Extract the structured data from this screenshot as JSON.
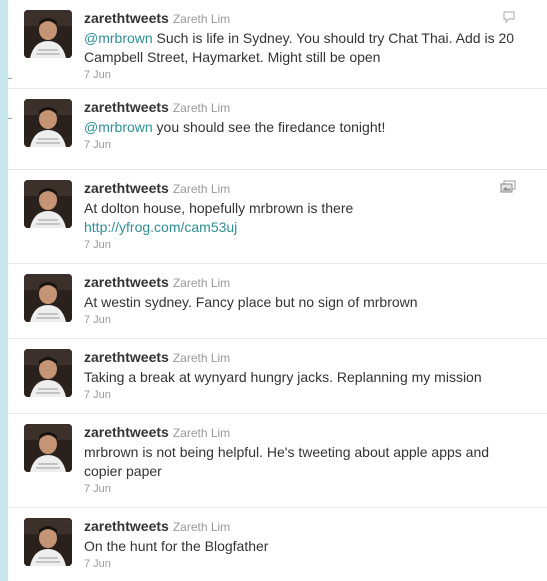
{
  "tweets": [
    {
      "screen_name": "zarethtweets",
      "full_name": "Zareth Lim",
      "mention": "@mrbrown",
      "text": " Such is life in Sydney. You should try Chat Thai. Add is 20 Campbell Street, Haymarket. Might still be open",
      "link": "",
      "time": "7 Jun",
      "icon": "speech-bubble-icon"
    },
    {
      "screen_name": "zarethtweets",
      "full_name": "Zareth Lim",
      "mention": "@mrbrown",
      "text": " you should see the firedance tonight!",
      "link": "",
      "time": "7 Jun",
      "icon": ""
    },
    {
      "screen_name": "zarethtweets",
      "full_name": "Zareth Lim",
      "mention": "",
      "text": "At dolton house, hopefully mrbrown is there",
      "link": "http://yfrog.com/cam53uj",
      "time": "7 Jun",
      "icon": "photo-icon"
    },
    {
      "screen_name": "zarethtweets",
      "full_name": "Zareth Lim",
      "mention": "",
      "text": "At westin sydney. Fancy place but no sign of mrbrown",
      "link": "",
      "time": "7 Jun",
      "icon": ""
    },
    {
      "screen_name": "zarethtweets",
      "full_name": "Zareth Lim",
      "mention": "",
      "text": "Taking a break at wynyard hungry jacks. Replanning my mission",
      "link": "",
      "time": "7 Jun",
      "icon": ""
    },
    {
      "screen_name": "zarethtweets",
      "full_name": "Zareth Lim",
      "mention": "",
      "text": "mrbrown is not being helpful. He's tweeting about apple apps and copier paper",
      "link": "",
      "time": "7 Jun",
      "icon": ""
    },
    {
      "screen_name": "zarethtweets",
      "full_name": "Zareth Lim",
      "mention": "",
      "text": "On the hunt for the Blogfather",
      "link": "",
      "time": "7 Jun",
      "icon": ""
    }
  ],
  "colors": {
    "link": "#2f8f93",
    "background": "#c7e6ea",
    "meta": "#999999"
  }
}
